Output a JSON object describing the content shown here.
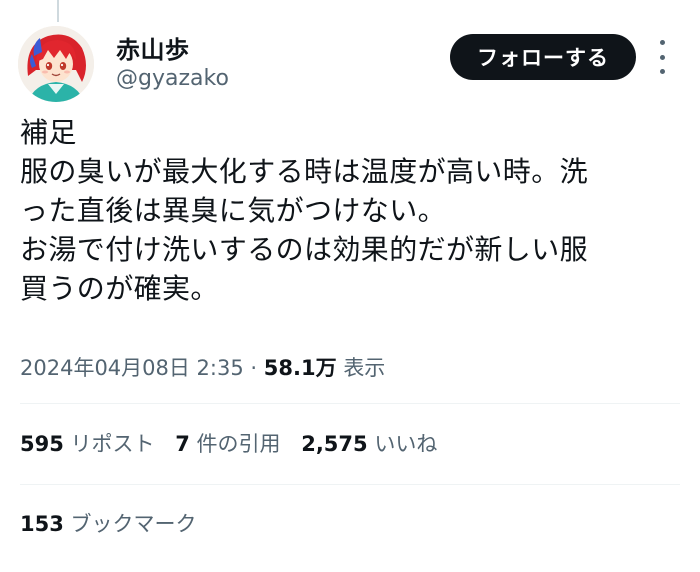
{
  "author": {
    "display_name": "赤山歩",
    "handle": "@gyazako",
    "avatar_icon": "anime-character-avatar"
  },
  "follow_label": "フォローする",
  "tweet": {
    "lines": [
      "補足",
      "服の臭いが最大化する時は温度が高い時。洗",
      "った直後は異臭に気がつけない。",
      "お湯で付け洗いするのは効果的だが新しい服",
      "買うのが確実。"
    ]
  },
  "meta": {
    "timestamp": "2024年04月08日 2:35",
    "separator": "·",
    "views_count": "58.1万",
    "views_label": "表示"
  },
  "stats": {
    "reposts_count": "595",
    "reposts_label": "リポスト",
    "quotes_count": "7",
    "quotes_label": "件の引用",
    "likes_count": "2,575",
    "likes_label": "いいね",
    "bookmarks_count": "153",
    "bookmarks_label": "ブックマーク"
  },
  "colors": {
    "text_primary": "#0f1419",
    "text_secondary": "#536471",
    "divider": "#eff3f4",
    "follow_bg": "#0f1419"
  }
}
